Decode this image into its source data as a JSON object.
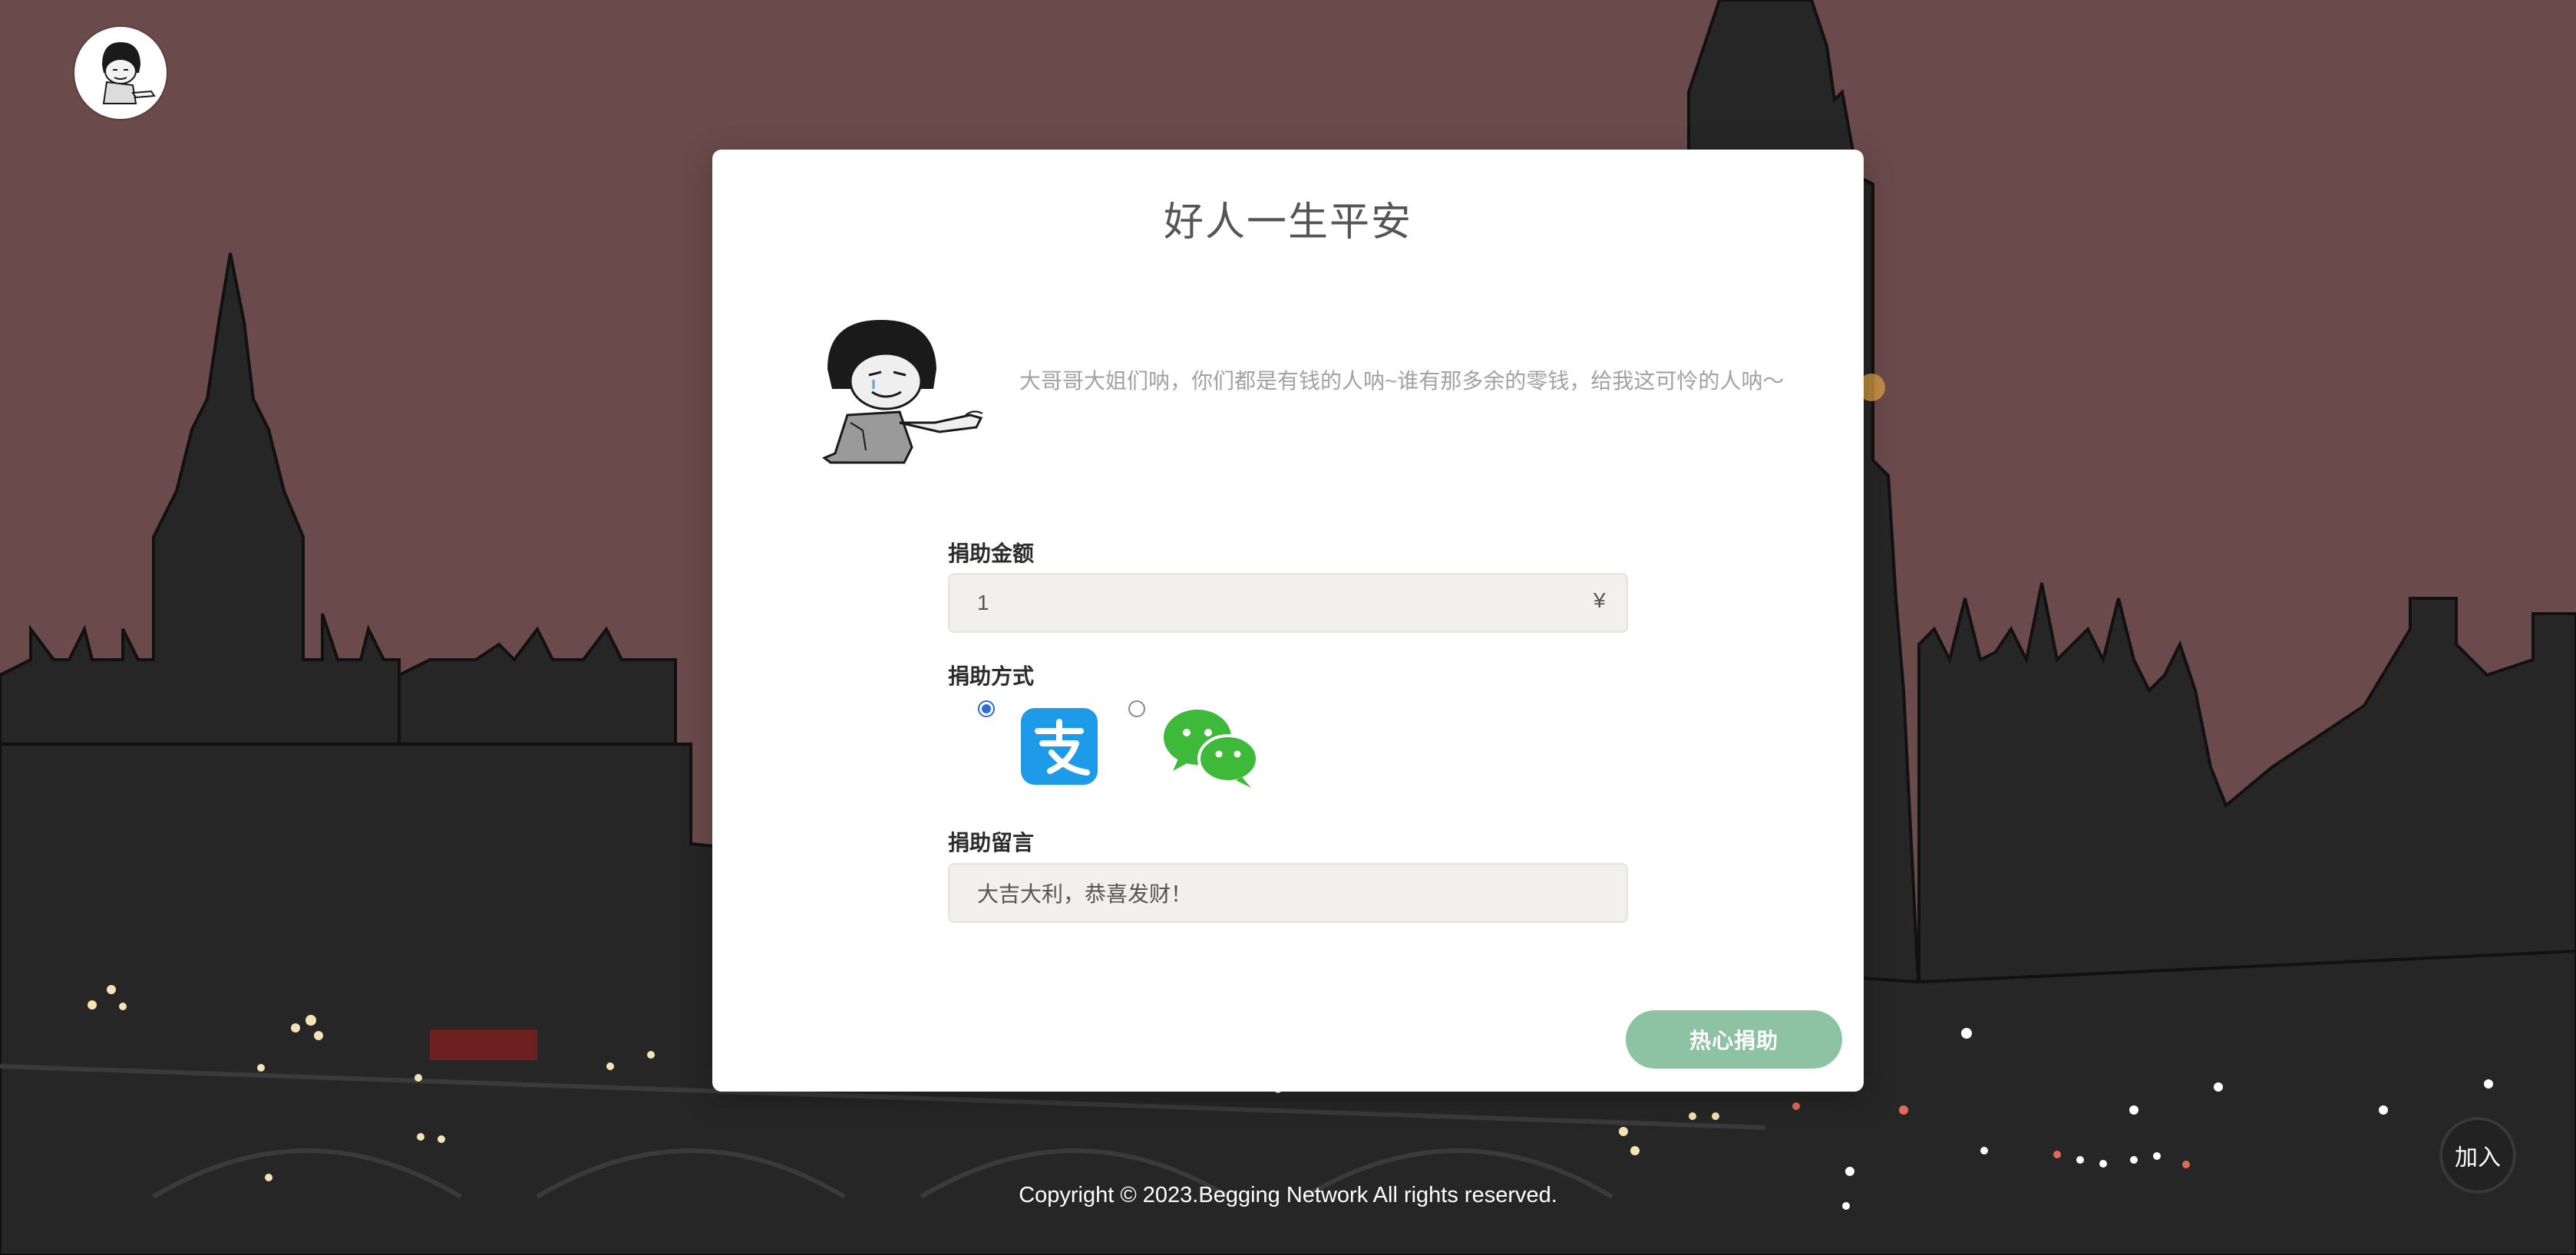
{
  "card": {
    "title": "好人一生平安",
    "beg_text": "大哥哥大姐们呐，你们都是有钱的人呐~谁有那多余的零钱，给我这可怜的人呐～"
  },
  "form": {
    "amount_label": "捐助金额",
    "amount_value": "1",
    "currency_symbol": "¥",
    "method_label": "捐助方式",
    "method_selected": "alipay",
    "message_label": "捐助留言",
    "message_value": "大吉大利，恭喜发财！",
    "submit_label": "热心捐助"
  },
  "footer": {
    "copyright": "Copyright © 2023.Begging Network All rights reserved."
  },
  "join_button": {
    "label": "加入"
  },
  "colors": {
    "background": "#6b4a4b",
    "submit_button": "#8dc3a2",
    "alipay": "#1e9be8",
    "wechat": "#3fb93a"
  },
  "icons": {
    "logo": "meme-face-icon",
    "illustration": "begging-meme-icon",
    "alipay": "alipay-icon",
    "wechat": "wechat-icon"
  }
}
